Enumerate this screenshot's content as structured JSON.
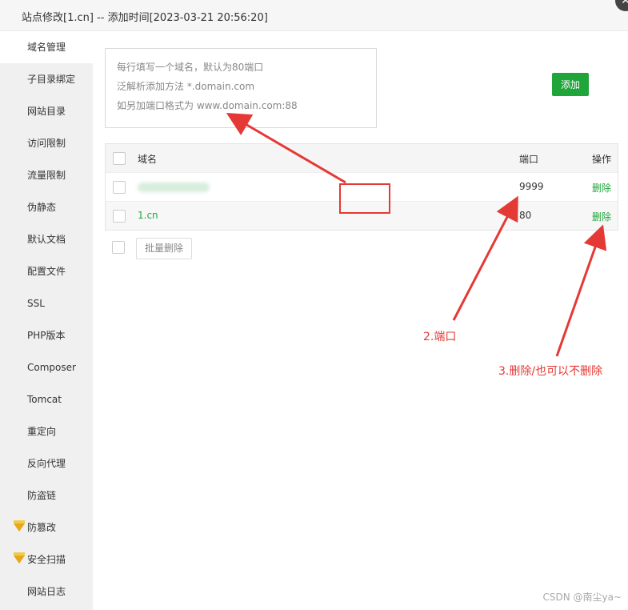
{
  "window": {
    "title": "站点修改[1.cn] -- 添加时间[2023-03-21 20:56:20]"
  },
  "sidebar": {
    "items": [
      {
        "label": "域名管理",
        "active": true
      },
      {
        "label": "子目录绑定"
      },
      {
        "label": "网站目录"
      },
      {
        "label": "访问限制"
      },
      {
        "label": "流量限制"
      },
      {
        "label": "伪静态"
      },
      {
        "label": "默认文档"
      },
      {
        "label": "配置文件"
      },
      {
        "label": "SSL"
      },
      {
        "label": "PHP版本"
      },
      {
        "label": "Composer"
      },
      {
        "label": "Tomcat"
      },
      {
        "label": "重定向"
      },
      {
        "label": "反向代理"
      },
      {
        "label": "防盗链"
      },
      {
        "label": "防篡改",
        "icon": "gem-icon"
      },
      {
        "label": "安全扫描",
        "icon": "gem-icon"
      },
      {
        "label": "网站日志"
      }
    ]
  },
  "domain_input": {
    "hint_lines": [
      "每行填写一个域名，默认为80端口",
      "泛解析添加方法 *.domain.com",
      "如另加端口格式为 www.domain.com:88"
    ]
  },
  "add_button": {
    "label": "添加"
  },
  "table": {
    "headers": {
      "domain": "域名",
      "port": "端口",
      "action": "操作"
    },
    "rows": [
      {
        "domain": "",
        "port": "9999",
        "action": "删除"
      },
      {
        "domain": "1.cn",
        "port": "80",
        "action": "删除"
      }
    ]
  },
  "batch_delete": {
    "label": "批量删除"
  },
  "annotations": {
    "port": "2.端口",
    "delete": "3.删除/也可以不删除"
  },
  "watermark": "CSDN @南尘ya~",
  "colors": {
    "accent": "#20a53a",
    "annotation": "#e53935"
  }
}
